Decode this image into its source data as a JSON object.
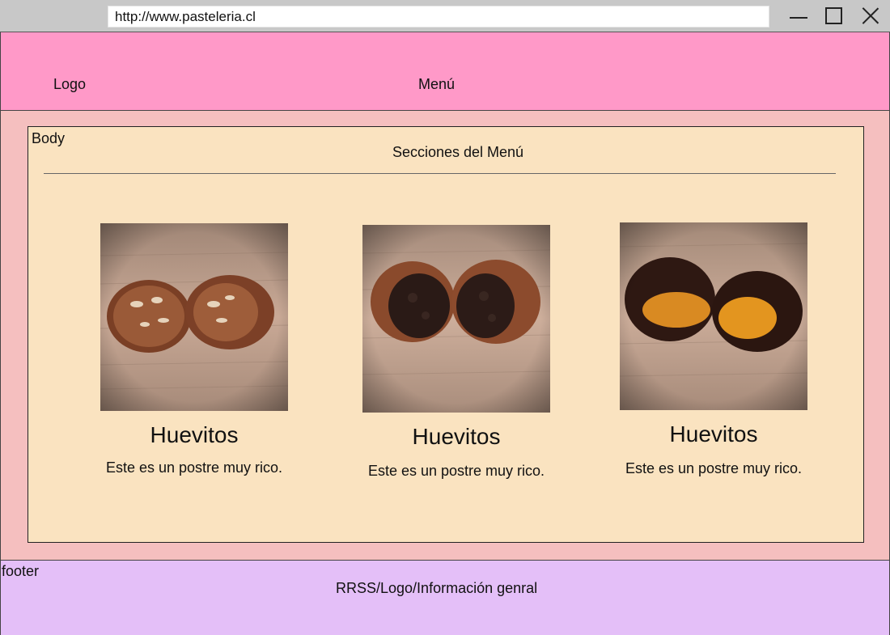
{
  "browser": {
    "url": "http://www.pasteleria.cl"
  },
  "header": {
    "logo": "Logo",
    "menu": "Menú"
  },
  "body": {
    "label": "Body",
    "sections_title": "Secciones del Menú",
    "cards": [
      {
        "title": "Huevitos",
        "description": "Este es un postre muy rico.",
        "image": "milk-chocolate-egg-with-nuts"
      },
      {
        "title": "Huevitos",
        "description": "Este es un postre muy rico.",
        "image": "milk-chocolate-egg-with-cookie-filling"
      },
      {
        "title": "Huevitos",
        "description": "Este es un postre muy rico.",
        "image": "dark-chocolate-egg-with-caramel"
      }
    ]
  },
  "footer": {
    "label": "footer",
    "info": "RRSS/Logo/Información genral"
  },
  "colors": {
    "header": "#ff99c8",
    "page": "#f5bfbf",
    "body_box": "#fae3c0",
    "footer": "#e4bff8"
  }
}
